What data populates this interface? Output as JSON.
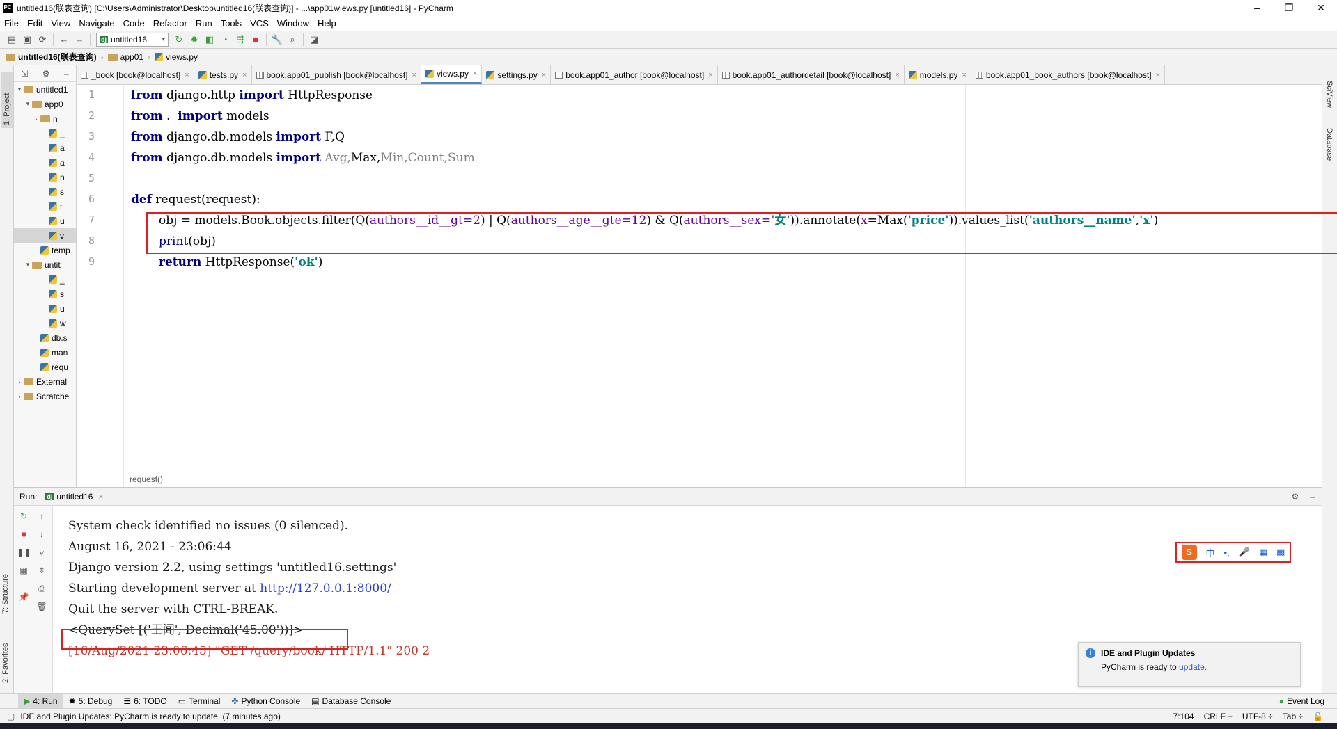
{
  "window": {
    "title": "untitled16(联表查询) [C:\\Users\\Administrator\\Desktop\\untitled16(联表查询)] - ...\\app01\\views.py [untitled16] - PyCharm",
    "app_badge": "PC",
    "controls": {
      "minimize": "–",
      "maximize": "❐",
      "close": "✕"
    }
  },
  "menu": [
    "File",
    "Edit",
    "View",
    "Navigate",
    "Code",
    "Refactor",
    "Run",
    "Tools",
    "VCS",
    "Window",
    "Help"
  ],
  "toolbar": {
    "run_config": "untitled16",
    "dj_badge": "dj"
  },
  "breadcrumb": [
    "untitled16(联表查询)",
    "app01",
    "views.py"
  ],
  "sidebar": {
    "tab_project": "1: Project",
    "tab_structure": "7: Structure",
    "tab_favorites": "2: Favorites",
    "tab_sciview": "SciView",
    "tab_database": "Database"
  },
  "project_tree": [
    {
      "label": "untitled1",
      "arrow": "▾"
    },
    {
      "label": "app0",
      "arrow": "▾"
    },
    {
      "label": "n",
      "arrow": "›"
    },
    {
      "label": "_",
      "arrow": ""
    },
    {
      "label": "a",
      "arrow": ""
    },
    {
      "label": "a",
      "arrow": ""
    },
    {
      "label": "n",
      "arrow": ""
    },
    {
      "label": "s",
      "arrow": ""
    },
    {
      "label": "t",
      "arrow": ""
    },
    {
      "label": "u",
      "arrow": ""
    },
    {
      "label": "v",
      "arrow": ""
    },
    {
      "label": "temp",
      "arrow": ""
    },
    {
      "label": "untit",
      "arrow": "▾"
    },
    {
      "label": "_",
      "arrow": ""
    },
    {
      "label": "s",
      "arrow": ""
    },
    {
      "label": "u",
      "arrow": ""
    },
    {
      "label": "w",
      "arrow": ""
    },
    {
      "label": "db.s",
      "arrow": ""
    },
    {
      "label": "man",
      "arrow": ""
    },
    {
      "label": "requ",
      "arrow": ""
    },
    {
      "label": "External",
      "arrow": "›"
    },
    {
      "label": "Scratche",
      "arrow": "›"
    }
  ],
  "tabs": [
    {
      "label": "_book [book@localhost]",
      "icon": "table"
    },
    {
      "label": "tests.py",
      "icon": "py"
    },
    {
      "label": "book.app01_publish [book@localhost]",
      "icon": "table"
    },
    {
      "label": "views.py",
      "icon": "py",
      "active": true
    },
    {
      "label": "settings.py",
      "icon": "py"
    },
    {
      "label": "book.app01_author [book@localhost]",
      "icon": "table"
    },
    {
      "label": "book.app01_authordetail [book@localhost]",
      "icon": "table"
    },
    {
      "label": "models.py",
      "icon": "py"
    },
    {
      "label": "book.app01_book_authors [book@localhost]",
      "icon": "table"
    }
  ],
  "code_lines": [
    "1",
    "2",
    "3",
    "4",
    "5",
    "6",
    "7",
    "8",
    "9"
  ],
  "code": {
    "l1_kw": "from",
    "l1_mod": " django.http ",
    "l1_kw2": "import",
    "l1_name": " HttpResponse",
    "l2_kw": "from",
    "l2_mod": " .  ",
    "l2_kw2": "import",
    "l2_name": " models",
    "l3_kw": "from",
    "l3_mod": " django.db.models ",
    "l3_kw2": "import",
    "l3_name": " F,Q",
    "l4_kw": "from",
    "l4_mod": " django.db.models ",
    "l4_kw2": "import",
    "l4_avg": " Avg,",
    "l4_max": "Max,",
    "l4_rest": "Min,Count,Sum",
    "l6_kw": "def",
    "l6_sig": " request(request):",
    "l7_a": "obj = models.Book.objects.filter(Q(",
    "l7_p1": "authors__id__gt=2",
    "l7_b": ") | Q(",
    "l7_p2": "authors__age__gte=12",
    "l7_c": ") & Q(",
    "l7_p3": "authors__sex=",
    "l7_s1": "'女'",
    "l7_d": ")).annotate(",
    "l7_p4": "x",
    "l7_e": "=Max(",
    "l7_s2": "'price'",
    "l7_f": ")).values_list(",
    "l7_s3": "'authors__name'",
    "l7_g": ",",
    "l7_s4": "'x'",
    "l7_h": ")",
    "l8_fn": "print",
    "l8_rest": "(obj)",
    "l9_kw": "return",
    "l9_a": " HttpResponse(",
    "l9_s": "'ok'",
    "l9_b": ")"
  },
  "editor_footer": "request()",
  "run": {
    "label": "Run:",
    "config": "untitled16",
    "console": [
      "System check identified no issues (0 silenced).",
      "August 16, 2021 - 23:06:44",
      "Django version 2.2, using settings 'untitled16.settings'",
      "Starting development server at ",
      "http://127.0.0.1:8000/",
      "Quit the server with CTRL-BREAK.",
      "<QuerySet [('王闻', Decimal('45.00'))]>",
      "[16/Aug/2021 23:06:45] \"GET /query/book/ HTTP/1.1\" 200 2"
    ]
  },
  "ime": {
    "logo": "S",
    "lang": "中",
    "punct": "•,",
    "mic": "🎤",
    "kbd": "▦",
    "grid": "▩"
  },
  "notification": {
    "title": "IDE and Plugin Updates",
    "body": "PyCharm is ready to ",
    "link": "update."
  },
  "toolwindows": [
    "4: Run",
    "5: Debug",
    "6: TODO",
    "Terminal",
    "Python Console",
    "Database Console"
  ],
  "event_log": "Event Log",
  "status": {
    "message": "IDE and Plugin Updates: PyCharm is ready to update. (7 minutes ago)",
    "position": "7:104",
    "line_sep": "CRLF ÷",
    "encoding": "UTF-8 ÷",
    "indent": "Tab ÷"
  }
}
